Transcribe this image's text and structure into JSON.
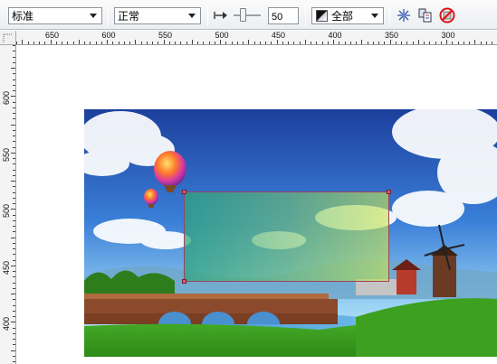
{
  "toolbar": {
    "transparency_type": "标准",
    "merge_mode": "正常",
    "transparency_value": "50",
    "target": "全部",
    "icons": [
      "transparency-midpoint-icon",
      "freeze-icon",
      "copy-transparency-icon",
      "clear-transparency-icon"
    ]
  },
  "rulers": {
    "horizontal": [
      "650",
      "600",
      "550",
      "500",
      "450",
      "400",
      "350",
      "300"
    ],
    "vertical": [
      "600",
      "550",
      "500",
      "450",
      "400"
    ]
  },
  "canvas": {
    "photo_description_tag": "landscape-photo",
    "colors": {
      "selection_start": "#2da57d",
      "selection_end": "#c8e650",
      "handle": "#e05a6a"
    }
  }
}
